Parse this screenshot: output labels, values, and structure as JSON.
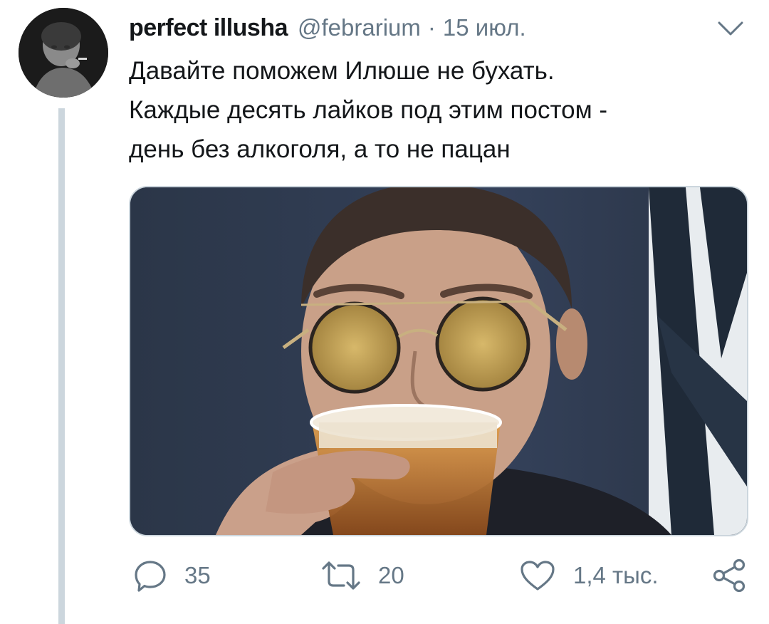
{
  "tweet": {
    "author": {
      "display_name": "perfect illusha",
      "handle": "@febrarium"
    },
    "separator": "·",
    "date": "15 июл.",
    "text_lines": [
      "Давайте поможем Илюше не бухать.",
      "Каждые десять лайков под этим постом -",
      "день без алкоголя, а то не пацан"
    ],
    "icons": {
      "avatar": "avatar-photo",
      "menu": "chevron-down-icon",
      "media": "photo-man-drinking-beer"
    },
    "actions": {
      "reply_count": "35",
      "retweet_count": "20",
      "like_count": "1,4 тыс."
    },
    "colors": {
      "text": "#14171a",
      "secondary": "#657786",
      "thread_line": "#ccd6dd"
    }
  }
}
